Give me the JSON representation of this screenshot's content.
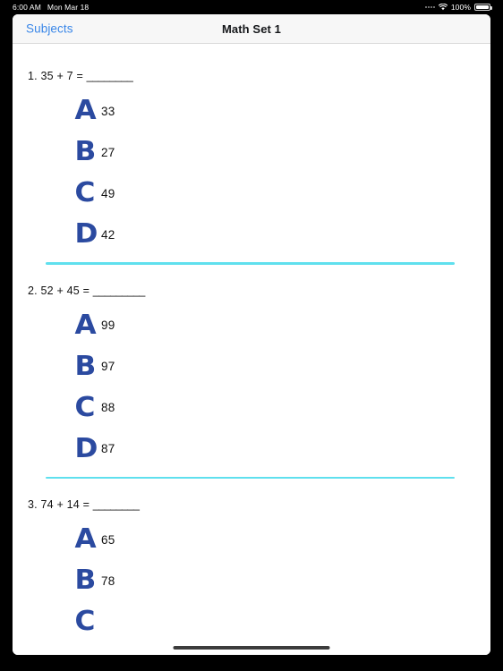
{
  "status_bar": {
    "time": "6:00 AM",
    "date": "Mon Mar 18",
    "battery_percent": "100%",
    "wifi_icon": "wifi-icon",
    "signal_icon": "signal-dots-icon",
    "battery_icon": "battery-icon"
  },
  "nav": {
    "back_label": "Subjects",
    "title": "Math Set 1"
  },
  "theme": {
    "link_blue": "#3A87E8",
    "letter_blue": "#2B4AA0",
    "divider_cyan": "#5FE0EE",
    "navbar_bg": "#F7F7F7",
    "page_bg": "#FFFFFF"
  },
  "questions": [
    {
      "number": "1.",
      "prompt": "1. 35 + 7 = ",
      "blank": "________",
      "options": [
        {
          "letter": "A",
          "value": "33"
        },
        {
          "letter": "B",
          "value": "27"
        },
        {
          "letter": "C",
          "value": "49"
        },
        {
          "letter": "D",
          "value": "42"
        }
      ]
    },
    {
      "number": "2.",
      "prompt": "2. 52 + 45 = ",
      "blank": "_________",
      "options": [
        {
          "letter": "A",
          "value": "99"
        },
        {
          "letter": "B",
          "value": "97"
        },
        {
          "letter": "C",
          "value": "88"
        },
        {
          "letter": "D",
          "value": "87"
        }
      ]
    },
    {
      "number": "3.",
      "prompt": "3. 74 + 14 = ",
      "blank": "________",
      "options": [
        {
          "letter": "A",
          "value": "65"
        },
        {
          "letter": "B",
          "value": "78"
        },
        {
          "letter": "C",
          "value": ""
        }
      ]
    }
  ]
}
